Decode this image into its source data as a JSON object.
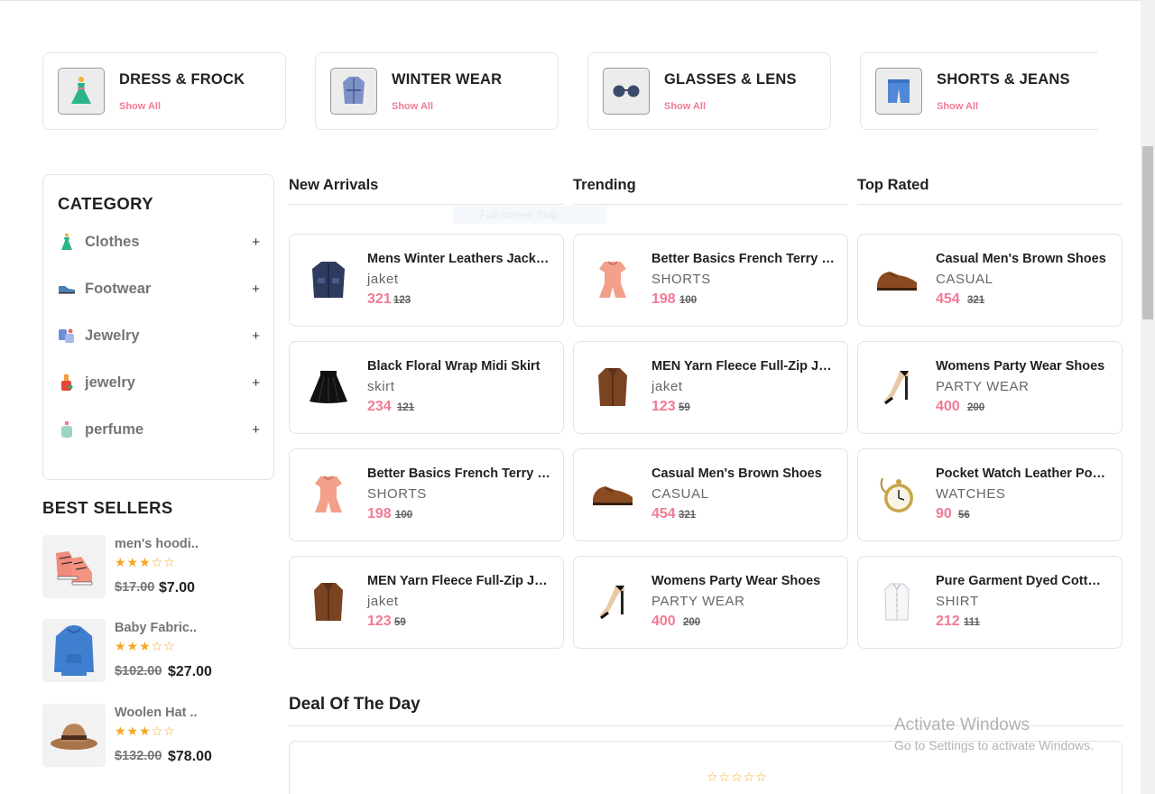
{
  "categories": [
    {
      "title": "DRESS & FROCK",
      "show_all": "Show All",
      "icon": "dress-icon"
    },
    {
      "title": "WINTER WEAR",
      "show_all": "Show All",
      "icon": "coat-icon"
    },
    {
      "title": "GLASSES & LENS",
      "show_all": "Show All",
      "icon": "glasses-icon"
    },
    {
      "title": "SHORTS & JEANS",
      "show_all": "Show All",
      "icon": "shorts-icon"
    }
  ],
  "sidebar": {
    "title": "CATEGORY",
    "items": [
      {
        "label": "Clothes",
        "icon": "dress-icon",
        "toggle": "+"
      },
      {
        "label": "Footwear",
        "icon": "shoe-icon",
        "toggle": "+"
      },
      {
        "label": "Jewelry",
        "icon": "jewelry-icon",
        "toggle": "+"
      },
      {
        "label": "jewelry",
        "icon": "nail-polish-icon",
        "toggle": "+"
      },
      {
        "label": "perfume",
        "icon": "perfume-icon",
        "toggle": "+"
      }
    ]
  },
  "best_sellers": {
    "title": "BEST SELLERS",
    "items": [
      {
        "name": "men's hoodi..",
        "stars": "★★★☆☆",
        "rating": 3,
        "old_price": "$17.00",
        "price": "$7.00",
        "icon": "sneaker-icon"
      },
      {
        "name": "Baby Fabric..",
        "stars": "★★★☆☆",
        "rating": 3,
        "old_price": "$102.00",
        "price": "$27.00",
        "icon": "hoodie-icon"
      },
      {
        "name": "Woolen Hat ..",
        "stars": "★★★☆☆",
        "rating": 3,
        "old_price": "$132.00",
        "price": "$78.00",
        "icon": "hat-icon"
      }
    ]
  },
  "columns": [
    {
      "title": "New Arrivals",
      "products": [
        {
          "name": "Mens Winter Leathers Jackets",
          "category": "jaket",
          "price": "321",
          "old_price": "123",
          "icon": "jacket-icon"
        },
        {
          "name": "Black Floral Wrap Midi Skirt",
          "category": "skirt",
          "price": "234",
          "old_price": "121",
          "icon": "skirt-icon"
        },
        {
          "name": "Better Basics French Terry Shorts",
          "category": "SHORTS",
          "price": "198",
          "old_price": "100",
          "icon": "romper-icon"
        },
        {
          "name": "MEN Yarn Fleece Full-Zip Jacket",
          "category": "jaket",
          "price": "123",
          "old_price": "59",
          "icon": "coat-icon"
        }
      ]
    },
    {
      "title": "Trending",
      "products": [
        {
          "name": "Better Basics French Terry Shorts",
          "category": "SHORTS",
          "price": "198",
          "old_price": "100",
          "icon": "romper-icon"
        },
        {
          "name": "MEN Yarn Fleece Full-Zip Jacket",
          "category": "jaket",
          "price": "123",
          "old_price": "59",
          "icon": "coat-icon"
        },
        {
          "name": "Casual Men's Brown Shoes",
          "category": "CASUAL",
          "price": "454",
          "old_price": "321",
          "icon": "shoe-icon"
        },
        {
          "name": "Womens Party Wear Shoes",
          "category": "PARTY WEAR",
          "price": "400",
          "old_price": "200",
          "icon": "heel-icon"
        }
      ]
    },
    {
      "title": "Top Rated",
      "products": [
        {
          "name": "Casual Men's Brown Shoes",
          "category": "CASUAL",
          "price": "454",
          "old_price": "321",
          "icon": "shoe-icon"
        },
        {
          "name": "Womens Party Wear Shoes",
          "category": "PARTY WEAR",
          "price": "400",
          "old_price": "200",
          "icon": "heel-icon"
        },
        {
          "name": "Pocket Watch Leather Pouch",
          "category": "WATCHES",
          "price": "90",
          "old_price": "56",
          "icon": "watch-icon"
        },
        {
          "name": "Pure Garment Dyed Cotton Shirt",
          "category": "SHIRT",
          "price": "212",
          "old_price": "111",
          "icon": "shirt-icon"
        }
      ]
    }
  ],
  "ghost_text": "Full-screen Snip",
  "deal": {
    "title": "Deal Of The Day",
    "stars": "☆☆☆☆☆"
  },
  "watermark": {
    "line1": "Activate Windows",
    "line2": "Go to Settings to activate Windows."
  },
  "colors": {
    "accent": "#f27a94",
    "star": "#f5a623",
    "border": "#e3e3e3"
  }
}
